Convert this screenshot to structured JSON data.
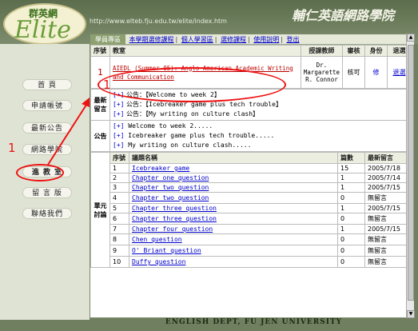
{
  "header": {
    "logo_cn": "群英網",
    "logo_en": "Elite",
    "url": "http://www.elteb.fju.edu.tw/elite/index.htm",
    "site_title": "輔仁英語網路學院"
  },
  "sidebar": {
    "items": [
      {
        "label": "首 頁"
      },
      {
        "label": "申請帳號"
      },
      {
        "label": "最新公告"
      },
      {
        "label": "網路學院"
      },
      {
        "label": "進 教 室"
      },
      {
        "label": "留 言 版"
      },
      {
        "label": "聯絡我們"
      }
    ],
    "annotation_1": "1"
  },
  "tabs": {
    "current": "學員專區",
    "items": [
      "本學期選修課程",
      "個人學習區",
      "選修課程",
      "使用說明",
      "登出"
    ]
  },
  "course_table": {
    "headers": [
      "序號",
      "教室",
      "授課教師",
      "審核",
      "身份",
      "退選"
    ],
    "row": {
      "index": "1",
      "title": "AIEDL (Summer 05): Anglo-American Academic Writing and Communication",
      "teacher": "Dr. Margarette R. Connor",
      "status": "核可",
      "role": "修",
      "drop": "退選"
    }
  },
  "latest_messages": {
    "label": "最新留言",
    "items": [
      {
        "plus": "[+]",
        "prefix": "公告：",
        "text": "【Welcome to week 2】"
      },
      {
        "plus": "[+]",
        "prefix": "公告：",
        "text": "【Icebreaker game plus tech trouble】"
      },
      {
        "plus": "[+]",
        "prefix": "公告：",
        "text": "【My writing on culture clash】"
      }
    ]
  },
  "announcements": {
    "label": "公告",
    "items": [
      {
        "plus": "[+]",
        "text": "Welcome to week 2....."
      },
      {
        "plus": "[+]",
        "text": "Icebreaker game plus tech trouble....."
      },
      {
        "plus": "[+]",
        "text": "My writing on culture clash....."
      }
    ]
  },
  "discussion": {
    "label": "單元討論",
    "headers": [
      "序號",
      "議題名稱",
      "篇數",
      "最新留言"
    ],
    "rows": [
      {
        "n": "1",
        "topic": "Icebreaker game",
        "count": "15",
        "latest": "2005/7/18"
      },
      {
        "n": "2",
        "topic": "Chapter one question",
        "count": "1",
        "latest": "2005/7/14"
      },
      {
        "n": "3",
        "topic": "Chapter two question",
        "count": "1",
        "latest": "2005/7/15"
      },
      {
        "n": "4",
        "topic": "Chapter two question",
        "count": "0",
        "latest": "無留言"
      },
      {
        "n": "5",
        "topic": "Chapter three question",
        "count": "1",
        "latest": "2005/7/15"
      },
      {
        "n": "6",
        "topic": "Chapter three question",
        "count": "0",
        "latest": "無留言"
      },
      {
        "n": "7",
        "topic": "Chapter four question",
        "count": "1",
        "latest": "2005/7/15"
      },
      {
        "n": "8",
        "topic": "Chen question",
        "count": "0",
        "latest": "無留言"
      },
      {
        "n": "9",
        "topic": "O' Briant question",
        "count": "0",
        "latest": "無留言"
      },
      {
        "n": "10",
        "topic": "Duffy question",
        "count": "0",
        "latest": "無留言"
      }
    ]
  },
  "annotations": {
    "course_number": "1"
  },
  "footer": {
    "text": "ENGLISH DEPT, FU JEN UNIVERSITY"
  },
  "colors": {
    "annotation_red": "#e11111",
    "link_blue": "#0000cc"
  }
}
